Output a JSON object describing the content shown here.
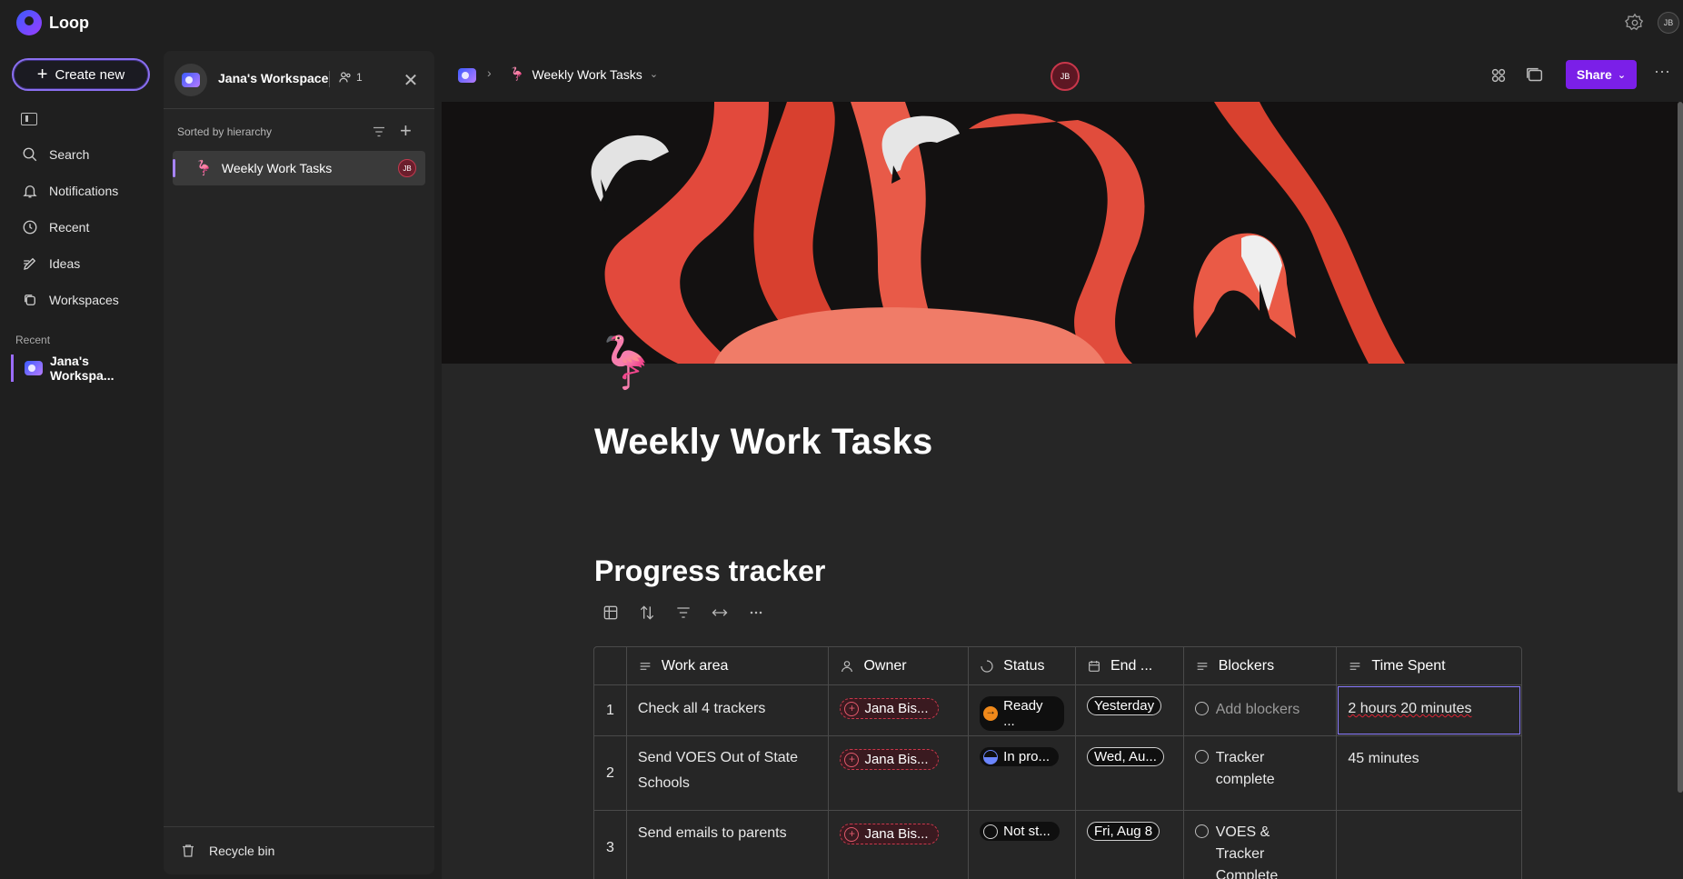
{
  "app": {
    "name": "Loop",
    "user_initials": "JB"
  },
  "rail": {
    "create_label": "Create new",
    "nav": [
      {
        "label": "Search",
        "icon": "search-icon"
      },
      {
        "label": "Notifications",
        "icon": "bell-icon"
      },
      {
        "label": "Recent",
        "icon": "clock-icon"
      },
      {
        "label": "Ideas",
        "icon": "pen-icon"
      },
      {
        "label": "Workspaces",
        "icon": "workspaces-icon"
      }
    ],
    "recent_heading": "Recent",
    "recent_item": "Jana's Workspa..."
  },
  "panel": {
    "title": "Jana's Workspace",
    "members_count": "1",
    "sort_label": "Sorted by hierarchy",
    "page_item": {
      "emoji": "🦩",
      "label": "Weekly Work Tasks",
      "avatar": "JB"
    },
    "recycle_label": "Recycle bin"
  },
  "header": {
    "page_name": "Weekly Work Tasks",
    "presence_initials": "JB",
    "share_label": "Share"
  },
  "page": {
    "emoji": "🦩",
    "title": "Weekly Work Tasks",
    "section_title": "Progress tracker"
  },
  "table": {
    "columns": [
      "Work area",
      "Owner",
      "Status",
      "End ...",
      "Blockers",
      "Time Spent"
    ],
    "rows": [
      {
        "num": "1",
        "work": "Check all 4 trackers",
        "owner": "Jana Bis...",
        "status": "Ready ...",
        "end": "Yesterday",
        "blockers": "Add blockers",
        "time": "2 hours 20 minutes"
      },
      {
        "num": "2",
        "work": "Send VOES Out of State Schools",
        "owner": "Jana Bis...",
        "status": "In pro...",
        "end": "Wed, Au...",
        "blockers": "Tracker complete",
        "time": "45 minutes"
      },
      {
        "num": "3",
        "work": "Send emails to parents",
        "owner": "Jana Bis...",
        "status": "Not st...",
        "end": "Fri, Aug 8",
        "blockers": "VOES & Tracker Complete",
        "time": ""
      }
    ]
  },
  "colors": {
    "accent": "#7b1fe8",
    "status_ready": "#f0891a",
    "status_progress": "#6b86ff",
    "owner_border": "#c9374b"
  }
}
